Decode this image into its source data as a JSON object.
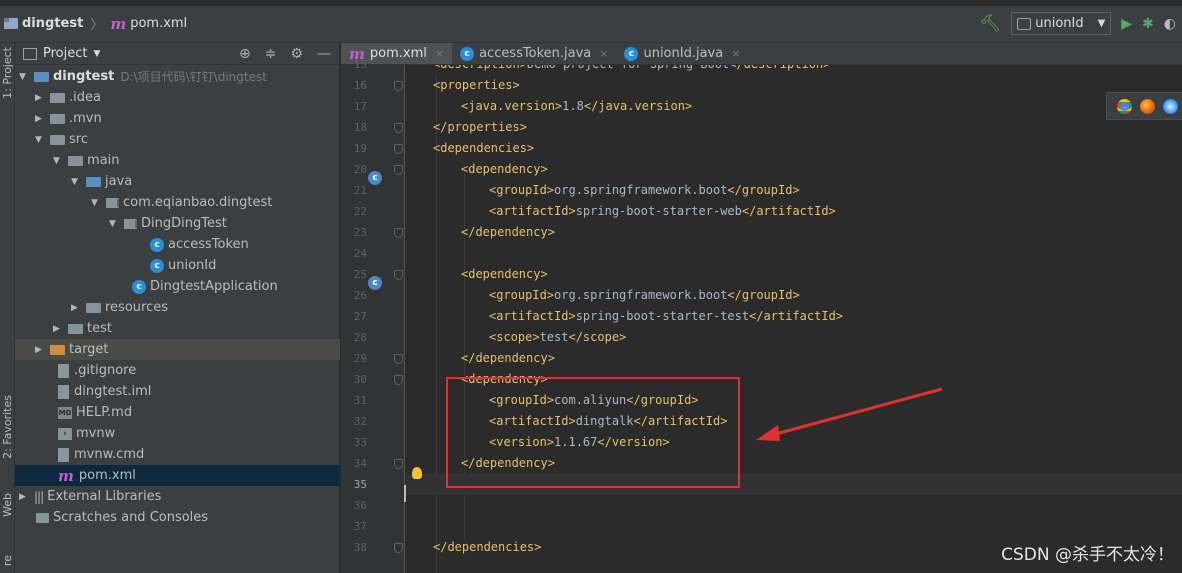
{
  "title": {
    "project": "dingtest",
    "file": "pom.xml"
  },
  "toolbar": {
    "run_config": "unionId"
  },
  "strip": {
    "project_tab": "1: Project",
    "favorites_tab": "2: Favorites",
    "web_tab": "Web",
    "bottom_tab": "re"
  },
  "panel": {
    "title": "Project"
  },
  "tree": [
    {
      "label": "dingtest",
      "path": "D:\\项目代码\\钉钉\\dingtest"
    },
    {
      "label": ".idea"
    },
    {
      "label": ".mvn"
    },
    {
      "label": "src"
    },
    {
      "label": "main"
    },
    {
      "label": "java"
    },
    {
      "label": "com.eqianbao.dingtest"
    },
    {
      "label": "DingDingTest"
    },
    {
      "label": "accessToken"
    },
    {
      "label": "unionId"
    },
    {
      "label": "DingtestApplication"
    },
    {
      "label": "resources"
    },
    {
      "label": "test"
    },
    {
      "label": "target"
    },
    {
      "label": ".gitignore"
    },
    {
      "label": "dingtest.iml"
    },
    {
      "label": "HELP.md"
    },
    {
      "label": "mvnw"
    },
    {
      "label": "mvnw.cmd"
    },
    {
      "label": "pom.xml"
    },
    {
      "label": "External Libraries"
    },
    {
      "label": "Scratches and Consoles"
    }
  ],
  "tabs": [
    {
      "label": "pom.xml",
      "active": true
    },
    {
      "label": "accessToken.java"
    },
    {
      "label": "unionId.java"
    }
  ],
  "editor": {
    "current_line": "35",
    "lines": [
      {
        "n": "15",
        "text": "<description>Demo project for Spring Boot</description>"
      },
      {
        "n": "16",
        "text": "<properties>"
      },
      {
        "n": "17",
        "text": "<java.version>1.8</java.version>"
      },
      {
        "n": "18",
        "text": "</properties>"
      },
      {
        "n": "19",
        "text": "<dependencies>"
      },
      {
        "n": "20",
        "text": "<dependency>"
      },
      {
        "n": "21",
        "text": "<groupId>org.springframework.boot</groupId>"
      },
      {
        "n": "22",
        "text": "<artifactId>spring-boot-starter-web</artifactId>"
      },
      {
        "n": "23",
        "text": "</dependency>"
      },
      {
        "n": "24",
        "text": ""
      },
      {
        "n": "25",
        "text": "<dependency>"
      },
      {
        "n": "26",
        "text": "<groupId>org.springframework.boot</groupId>"
      },
      {
        "n": "27",
        "text": "<artifactId>spring-boot-starter-test</artifactId>"
      },
      {
        "n": "28",
        "text": "<scope>test</scope>"
      },
      {
        "n": "29",
        "text": "</dependency>"
      },
      {
        "n": "30",
        "text": "<dependency>"
      },
      {
        "n": "31",
        "text": "<groupId>com.aliyun</groupId>"
      },
      {
        "n": "32",
        "text": "<artifactId>dingtalk</artifactId>"
      },
      {
        "n": "33",
        "text": "<version>1.1.67</version>"
      },
      {
        "n": "34",
        "text": "</dependency>"
      },
      {
        "n": "35",
        "text": ""
      },
      {
        "n": "36",
        "text": ""
      },
      {
        "n": "37",
        "text": ""
      },
      {
        "n": "38",
        "text": "</dependencies>"
      }
    ]
  },
  "watermark": "CSDN @杀手不太冷！",
  "colors": {
    "tag": "#e8bf6a",
    "text": "#a9b7c6",
    "annotation": "#e03131",
    "selection": "#0d293e"
  }
}
